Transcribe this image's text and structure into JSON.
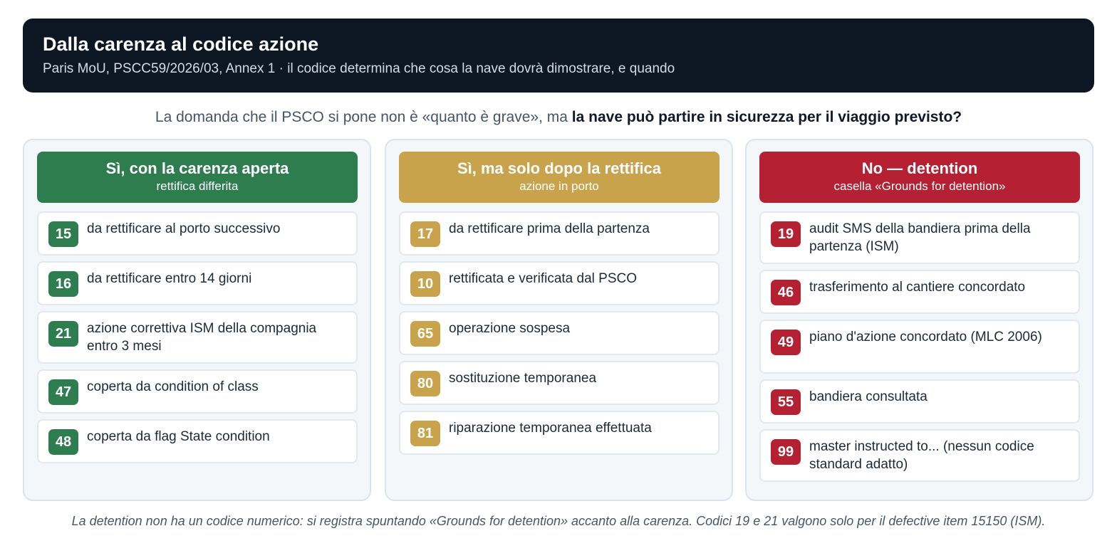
{
  "header": {
    "title": "Dalla carenza al codice azione",
    "subtitle": "Paris MoU, PSCC59/2026/03, Annex 1 · il codice determina che cosa la nave dovrà dimostrare, e quando"
  },
  "question": {
    "prefix": "La domanda che il PSCO si pone non è «quanto è grave», ma ",
    "emphasis": "la nave può partire in sicurezza per il viaggio previsto?"
  },
  "colors": {
    "green": "#2e7d4f",
    "gold": "#c9a24c",
    "red": "#b52033"
  },
  "columns": [
    {
      "title": "Sì, con la carenza aperta",
      "subtitle": "rettifica differita",
      "items": [
        {
          "code": "15",
          "text": "da rettificare al porto successivo"
        },
        {
          "code": "16",
          "text": "da rettificare entro 14 giorni"
        },
        {
          "code": "21",
          "text": "azione correttiva ISM della compagnia entro 3 mesi"
        },
        {
          "code": "47",
          "text": "coperta da condition of class"
        },
        {
          "code": "48",
          "text": "coperta da flag State condition"
        }
      ]
    },
    {
      "title": "Sì, ma solo dopo la rettifica",
      "subtitle": "azione in porto",
      "items": [
        {
          "code": "17",
          "text": "da rettificare prima della partenza"
        },
        {
          "code": "10",
          "text": "rettificata e verificata dal PSCO"
        },
        {
          "code": "65",
          "text": "operazione sospesa"
        },
        {
          "code": "80",
          "text": "sostituzione temporanea"
        },
        {
          "code": "81",
          "text": "riparazione temporanea effettuata"
        }
      ]
    },
    {
      "title": "No — detention",
      "subtitle": "casella «Grounds for detention»",
      "items": [
        {
          "code": "19",
          "text": "audit SMS della bandiera prima della partenza (ISM)"
        },
        {
          "code": "46",
          "text": "trasferimento al cantiere concordato"
        },
        {
          "code": "49",
          "text": "piano d'azione concordato (MLC 2006)"
        },
        {
          "code": "55",
          "text": "bandiera consultata"
        },
        {
          "code": "99",
          "text": "master instructed to... (nessun codice standard adatto)"
        }
      ]
    }
  ],
  "footer": "La detention non ha un codice numerico: si registra spuntando «Grounds for detention» accanto alla carenza. Codici 19 e 21 valgono solo per il defective item 15150 (ISM)."
}
